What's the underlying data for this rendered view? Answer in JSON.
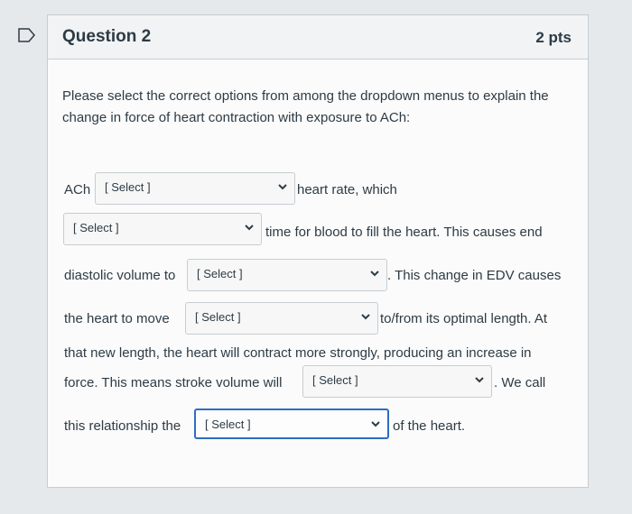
{
  "question": {
    "title": "Question 2",
    "points": "2 pts",
    "intro": "Please select the correct options from among the dropdown menus to explain the change in force of heart contraction with exposure to ACh:"
  },
  "select_placeholder": "[ Select ]",
  "text": {
    "s1_pre": "ACh",
    "s1_post": "heart rate, which",
    "s2_post": "time for blood to fill the heart. This causes end",
    "s3_pre": "diastolic volume to",
    "s3_post": ". This change in EDV causes",
    "s4_pre": "the heart to move",
    "s4_post": "to/from its optimal length. At",
    "s5": "that new length, the heart will contract more strongly, producing an increase in",
    "s6_pre": "force. This means stroke volume will",
    "s6_post": ". We call",
    "s7_pre": "this relationship the",
    "s7_post": "of the heart."
  },
  "colors": {
    "text": "#2d3b45",
    "focus_border": "#2d6ec1",
    "border": "#c7cdd1"
  },
  "icons": {
    "flag": "flag-icon",
    "dropdown": "chevron-down-icon"
  }
}
